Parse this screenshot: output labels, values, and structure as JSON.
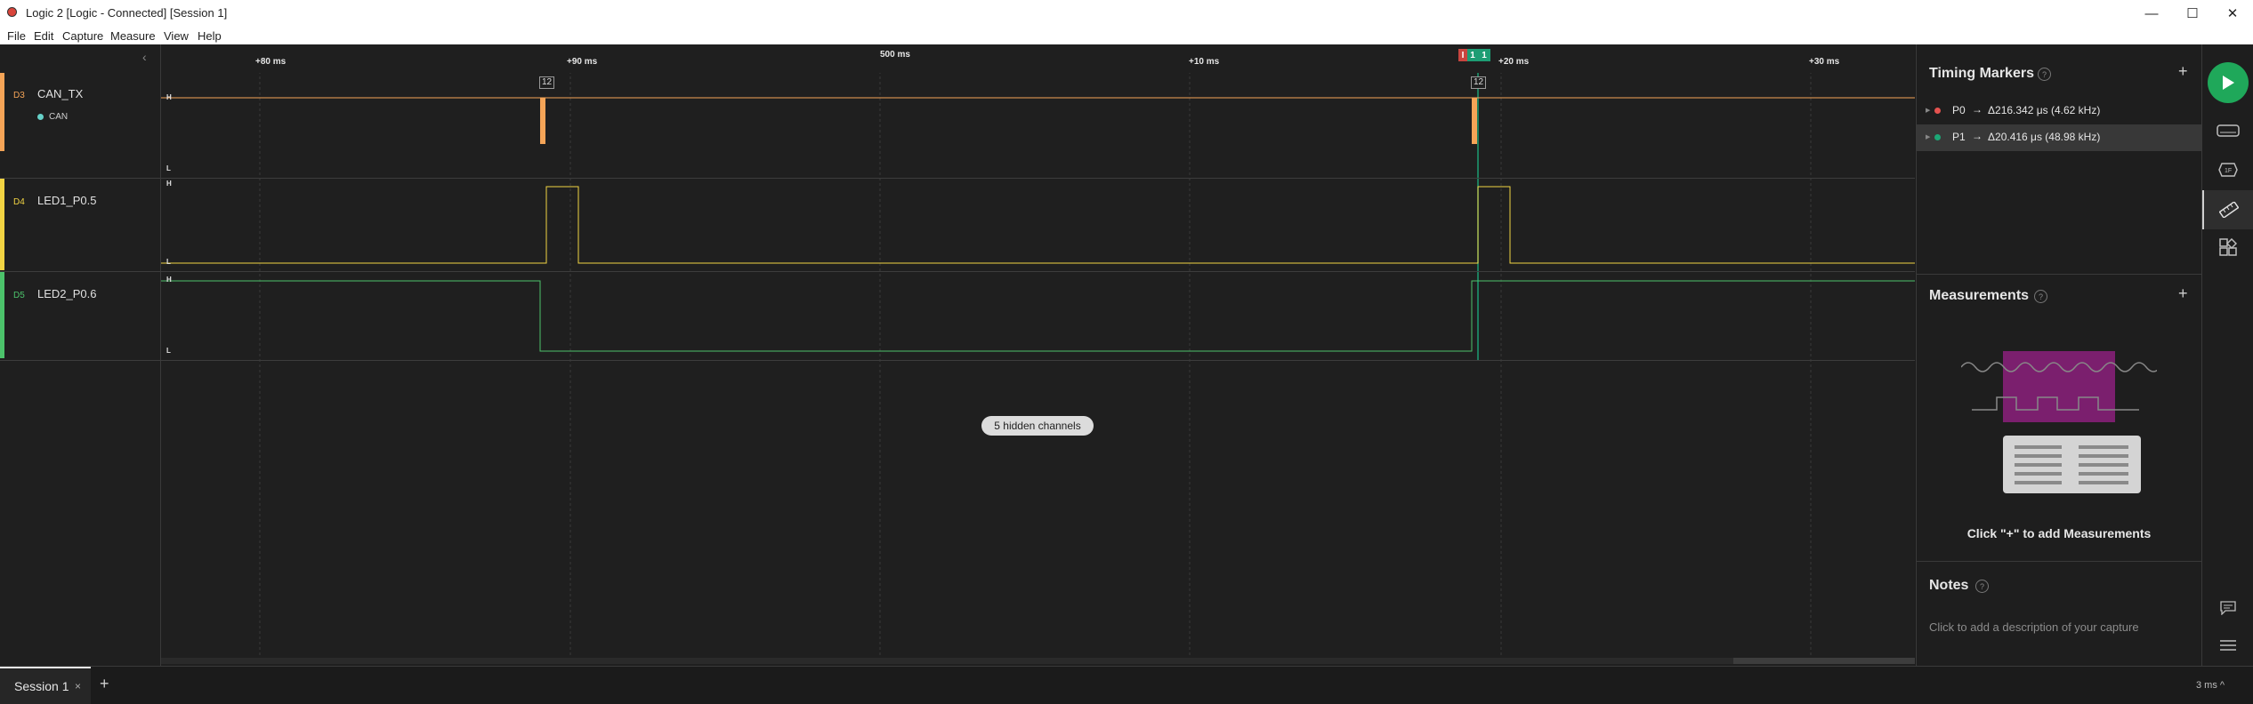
{
  "titlebar": {
    "title": "Logic 2 [Logic - Connected] [Session 1]",
    "minimize_glyph": "—",
    "maximize_glyph": "☐",
    "close_glyph": "✕"
  },
  "menu": [
    "File",
    "Edit",
    "Capture",
    "Measure",
    "View",
    "Help"
  ],
  "timeline": {
    "ticks": [
      "+80 ms",
      "+90 ms",
      "500 ms",
      "+10 ms",
      "+20 ms",
      "+30 ms"
    ]
  },
  "channels": [
    {
      "id": "D3",
      "name": "CAN_TX",
      "color": "#f5a457",
      "analyzer": "CAN",
      "analyzer_color": "#66d1c8"
    },
    {
      "id": "D4",
      "name": "LED1_P0.5",
      "color": "#f2d443"
    },
    {
      "id": "D5",
      "name": "LED2_P0.6",
      "color": "#4cc36b"
    }
  ],
  "level_labels": {
    "high": "H",
    "low": "L"
  },
  "packet_tags": [
    "12",
    "12"
  ],
  "marker_flags": [
    {
      "label": "I",
      "color": "#c9453f"
    },
    {
      "label": "1",
      "color": "#1d9d74"
    },
    {
      "label": "1",
      "color": "#1d9d74"
    }
  ],
  "hidden_channels_label": "5 hidden channels",
  "timing_markers": {
    "title": "Timing Markers",
    "items": [
      {
        "name": "P0",
        "value": "Δ216.342 μs (4.62 kHz)",
        "color": "#e4524f"
      },
      {
        "name": "P1",
        "value": "Δ20.416 μs (48.98 kHz)",
        "color": "#1ca776"
      }
    ]
  },
  "measurements": {
    "title": "Measurements",
    "hint": "Click \"+\" to add Measurements"
  },
  "notes": {
    "title": "Notes",
    "hint": "Click to add a description of your capture"
  },
  "tabs": {
    "session": "Session 1",
    "close": "×",
    "add": "+"
  },
  "zoom_readout": "3 ms ^",
  "colors": {
    "play": "#1fa85a",
    "accent_meas": "#7b1f6e"
  }
}
